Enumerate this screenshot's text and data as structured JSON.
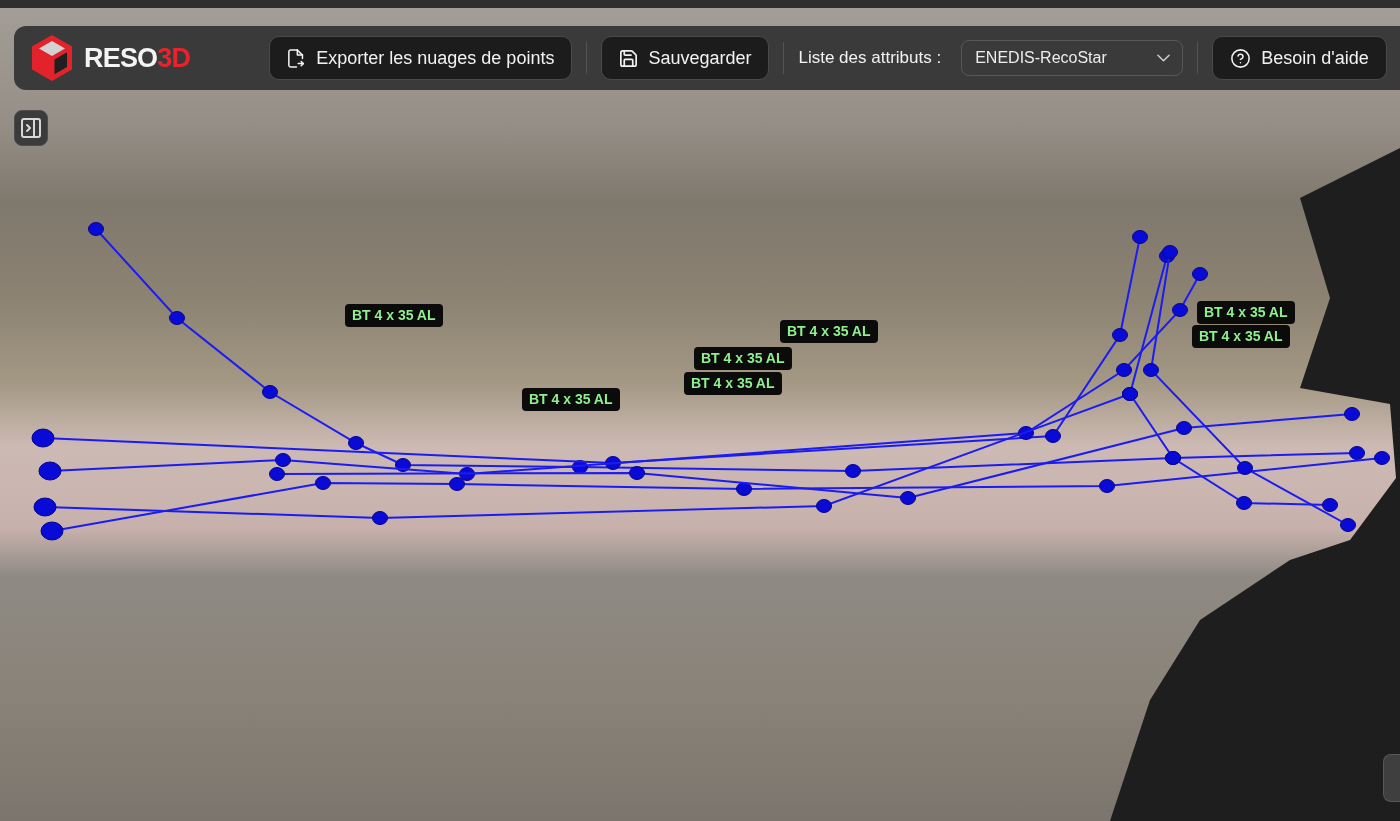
{
  "toolbar": {
    "logo": {
      "text": "RESO",
      "accent": "3D"
    },
    "actions": [
      {
        "kind": "export",
        "label": "Exporter les nuages de points"
      },
      {
        "kind": "save",
        "label": "Sauvegarder"
      }
    ],
    "attribute_list": {
      "label": "Liste des attributs :",
      "value": "ENEDIS-RecoStar"
    },
    "help_button": {
      "label": "Besoin d'aide"
    }
  },
  "viewer": {
    "cable_labels": [
      "BT 4 x 35 AL",
      "BT 4 x 35 AL",
      "BT 4 x 35 AL",
      "BT 4 x 35 AL",
      "BT 4 x 35 AL",
      "BT 4 x 35 AL",
      "BT 4 x 35 AL"
    ]
  }
}
